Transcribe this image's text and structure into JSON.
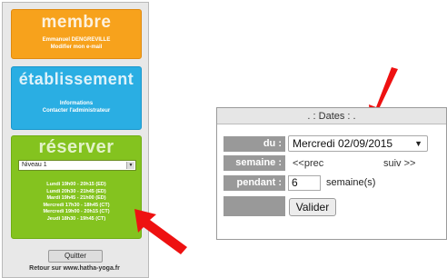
{
  "sidebar": {
    "membre": {
      "title": "membre",
      "member_name": "Emmanuel DENGREVILLE",
      "modify_label": "Modifier mon e-mail"
    },
    "etablissement": {
      "title": "établissement",
      "informations_label": "Informations",
      "contact_label": "Contacter l'administrateur"
    },
    "reserver": {
      "title": "réserver",
      "level_select_value": "Niveau 1",
      "courses": [
        "Lundi 19h00 - 20h15 (ED)",
        "Lundi 20h30 - 21h45 (ED)",
        "Mardi 19h45 - 21h00 (ED)",
        "Mercredi 17h30 - 18h45 (CT)",
        "Mercredi 19h00 - 20h15 (CT)",
        "Jeudi 18h30 - 19h45 (CT)"
      ]
    },
    "quit_label": "Quitter",
    "footer_link": "Retour sur www.hatha-yoga.fr"
  },
  "dates_form": {
    "header": ". : Dates : .",
    "du_label": "du :",
    "date_value": "Mercredi 02/09/2015",
    "semaine_label": "semaine :",
    "prev_label": "<<prec",
    "next_label": "suiv >>",
    "pendant_label": "pendant :",
    "pendant_value": "6",
    "weeks_unit": "semaine(s)",
    "submit_label": "Valider"
  },
  "colors": {
    "membre": "#f7a21c",
    "etablissement": "#2aaee3",
    "reserver": "#84c31f",
    "label_bg": "#999999",
    "arrow": "#ee1111"
  },
  "icons": [
    "select-dropdown-icon",
    "red-arrow-icon"
  ]
}
